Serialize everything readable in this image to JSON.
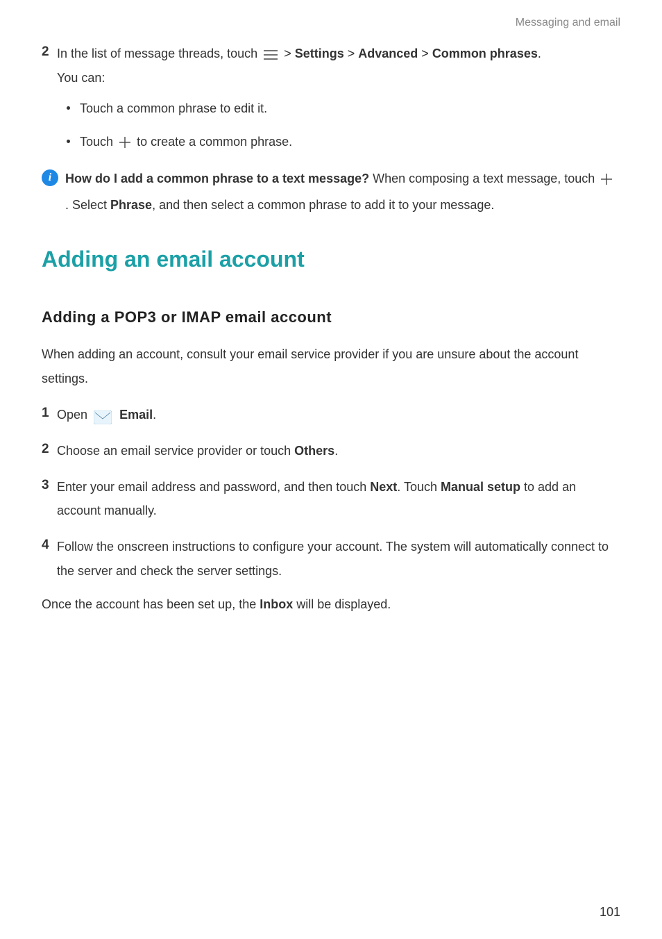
{
  "header": {
    "breadcrumb": "Messaging and email"
  },
  "step2": {
    "num": "2",
    "text_a": "In the list of message threads, touch ",
    "settings": "Settings",
    "advanced": "Advanced",
    "common_phrases": "Common phrases",
    "period": ".",
    "sep": " > ",
    "you_can": "You can:"
  },
  "bullets": {
    "b1": "Touch a common phrase to edit it.",
    "b2a": "Touch ",
    "b2b": " to create a common phrase."
  },
  "info": {
    "q": "How do I add a common phrase to a text message?",
    "a1": " When composing a text message, touch ",
    "a2": " . Select ",
    "phrase": "Phrase",
    "a3": ", and then select a common phrase to add it to your message."
  },
  "h1": "Adding an email account",
  "h2": "Adding a POP3 or IMAP email account",
  "intro": "When adding an account, consult your email service provider if you are unsure about the account settings.",
  "s1": {
    "num": "1",
    "a": "Open ",
    "email": "Email",
    "b": "."
  },
  "s2": {
    "num": "2",
    "a": "Choose an email service provider or touch ",
    "others": "Others",
    "b": "."
  },
  "s3": {
    "num": "3",
    "a": "Enter your email address and password, and then touch ",
    "next": "Next",
    "b": ". Touch ",
    "manual": "Manual setup",
    "c": " to add an account manually."
  },
  "s4": {
    "num": "4",
    "text": "Follow the onscreen instructions to configure your account. The system will automatically connect to the server and check the server settings."
  },
  "closing": {
    "a": "Once the account has been set up, the ",
    "inbox": "Inbox",
    "b": " will be displayed."
  },
  "page_number": "101"
}
